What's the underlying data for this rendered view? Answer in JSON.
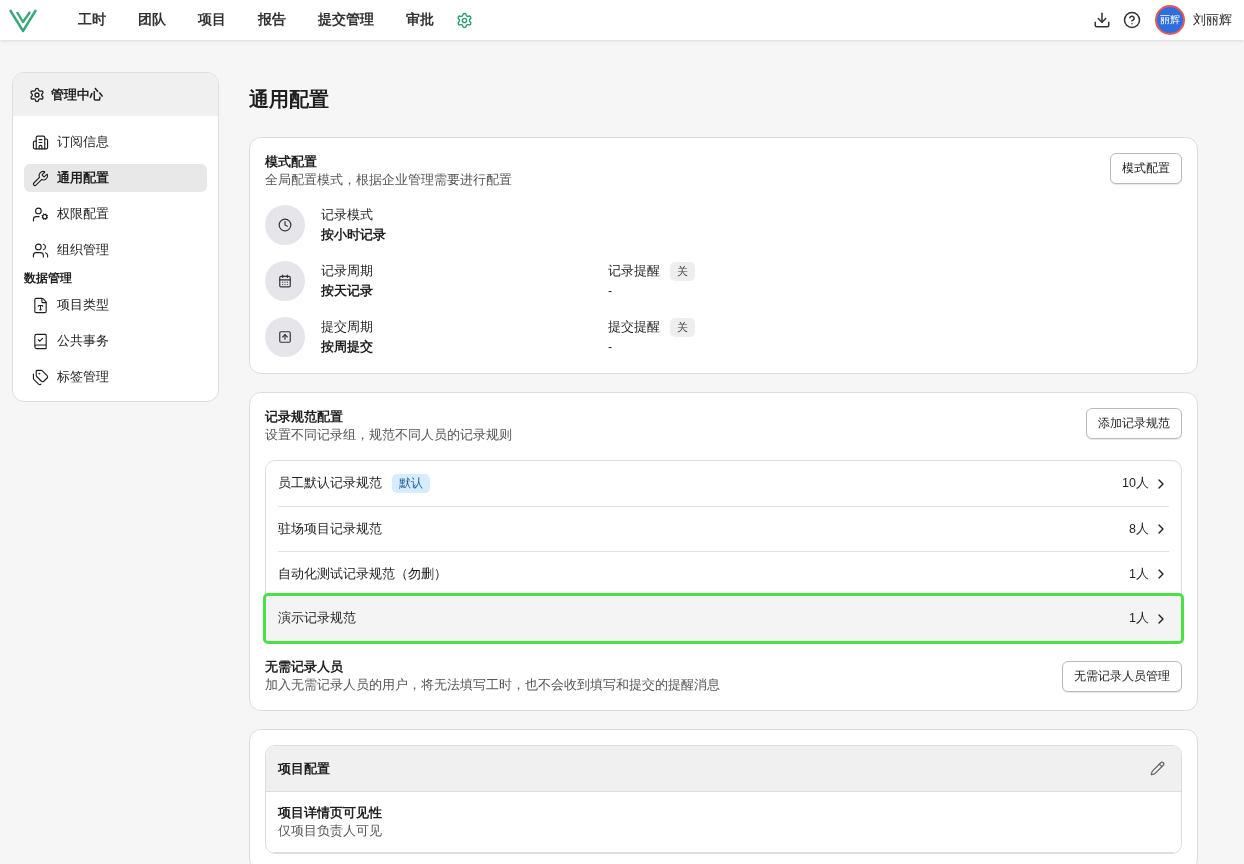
{
  "topbar": {
    "nav": [
      {
        "label": "工时",
        "selected": false
      },
      {
        "label": "团队",
        "selected": false
      },
      {
        "label": "项目",
        "selected": false
      },
      {
        "label": "报告",
        "selected": false
      },
      {
        "label": "提交管理",
        "selected": false
      },
      {
        "label": "审批",
        "selected": false
      }
    ],
    "settings_selected": true,
    "avatar_text": "丽辉",
    "user_name": "刘丽辉"
  },
  "sidebar": {
    "title": "管理中心",
    "items": [
      {
        "kind": "item",
        "label": "订阅信息",
        "selected": false
      },
      {
        "kind": "item",
        "label": "通用配置",
        "selected": true
      },
      {
        "kind": "item",
        "label": "权限配置",
        "selected": false
      },
      {
        "kind": "item",
        "label": "组织管理",
        "selected": false
      },
      {
        "kind": "heading",
        "label": "数据管理"
      },
      {
        "kind": "item",
        "label": "项目类型",
        "selected": false
      },
      {
        "kind": "item",
        "label": "公共事务",
        "selected": false
      },
      {
        "kind": "item",
        "label": "标签管理",
        "selected": false
      }
    ]
  },
  "page_title": "通用配置",
  "mode_card": {
    "title": "模式配置",
    "description": "全局配置模式，根据企业管理需要进行配置",
    "button": "模式配置",
    "settings": [
      {
        "label": "记录模式",
        "value": "按小时记录"
      },
      {
        "label": "记录周期",
        "value": "按天记录",
        "reminder_label": "记录提醒",
        "reminder_tag": "关",
        "reminder_value": "-"
      },
      {
        "label": "提交周期",
        "value": "按周提交",
        "reminder_label": "提交提醒",
        "reminder_tag": "关",
        "reminder_value": "-"
      }
    ]
  },
  "rules_card": {
    "title": "记录规范配置",
    "description": "设置不同记录组，规范不同人员的记录规则",
    "button": "添加记录规范",
    "rules": [
      {
        "name": "员工默认记录规范",
        "badge": "默认",
        "count": "10人",
        "highlighted": false
      },
      {
        "name": "驻场项目记录规范",
        "count": "8人",
        "highlighted": false
      },
      {
        "name": "自动化测试记录规范（勿删）",
        "count": "1人",
        "highlighted": false
      },
      {
        "name": "演示记录规范",
        "count": "1人",
        "highlighted": true
      }
    ],
    "exempt_title": "无需记录人员",
    "exempt_description": "加入无需记录人员的用户，将无法填写工时，也不会收到填写和提交的提醒消息",
    "exempt_button": "无需记录人员管理"
  },
  "project_card": {
    "title": "项目配置",
    "items": [
      {
        "title": "项目详情页可见性",
        "value": "仅项目负责人可见"
      }
    ]
  }
}
